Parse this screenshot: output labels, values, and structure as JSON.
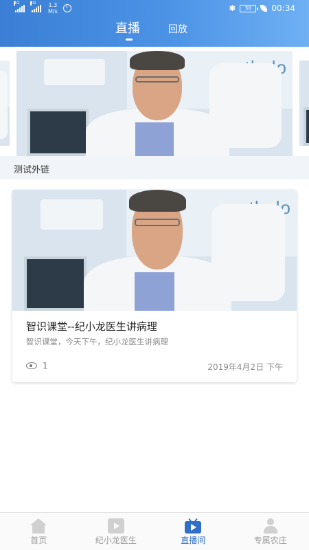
{
  "status_bar": {
    "network_left": "4G",
    "network_right": "2G",
    "speed_value": "1.3",
    "speed_unit": "M/s",
    "battery": "50",
    "time": "00:34"
  },
  "header": {
    "tabs": [
      {
        "label": "直播",
        "active": true
      },
      {
        "label": "回放",
        "active": false
      }
    ]
  },
  "carousel": {
    "caption": "测试外链",
    "photo_text": "patholo"
  },
  "card": {
    "photo_text": "patholo",
    "title": "智识课堂--纪小龙医生讲病理",
    "subtitle": "智识课堂，今天下午，纪小龙医生讲病理",
    "views": "1",
    "date": "2019年4月2日 下午"
  },
  "bottom_nav": {
    "items": [
      {
        "label": "首页",
        "icon": "home-icon",
        "active": false
      },
      {
        "label": "纪小龙医生",
        "icon": "film-icon",
        "active": false
      },
      {
        "label": "直播间",
        "icon": "tv-icon",
        "active": true
      },
      {
        "label": "专属农庄",
        "icon": "person-icon",
        "active": false
      }
    ]
  },
  "colors": {
    "header_start": "#3a7fd5",
    "header_end": "#6fb0f3",
    "active_nav": "#2f6fc7",
    "inactive_nav": "#9a9a9a"
  }
}
